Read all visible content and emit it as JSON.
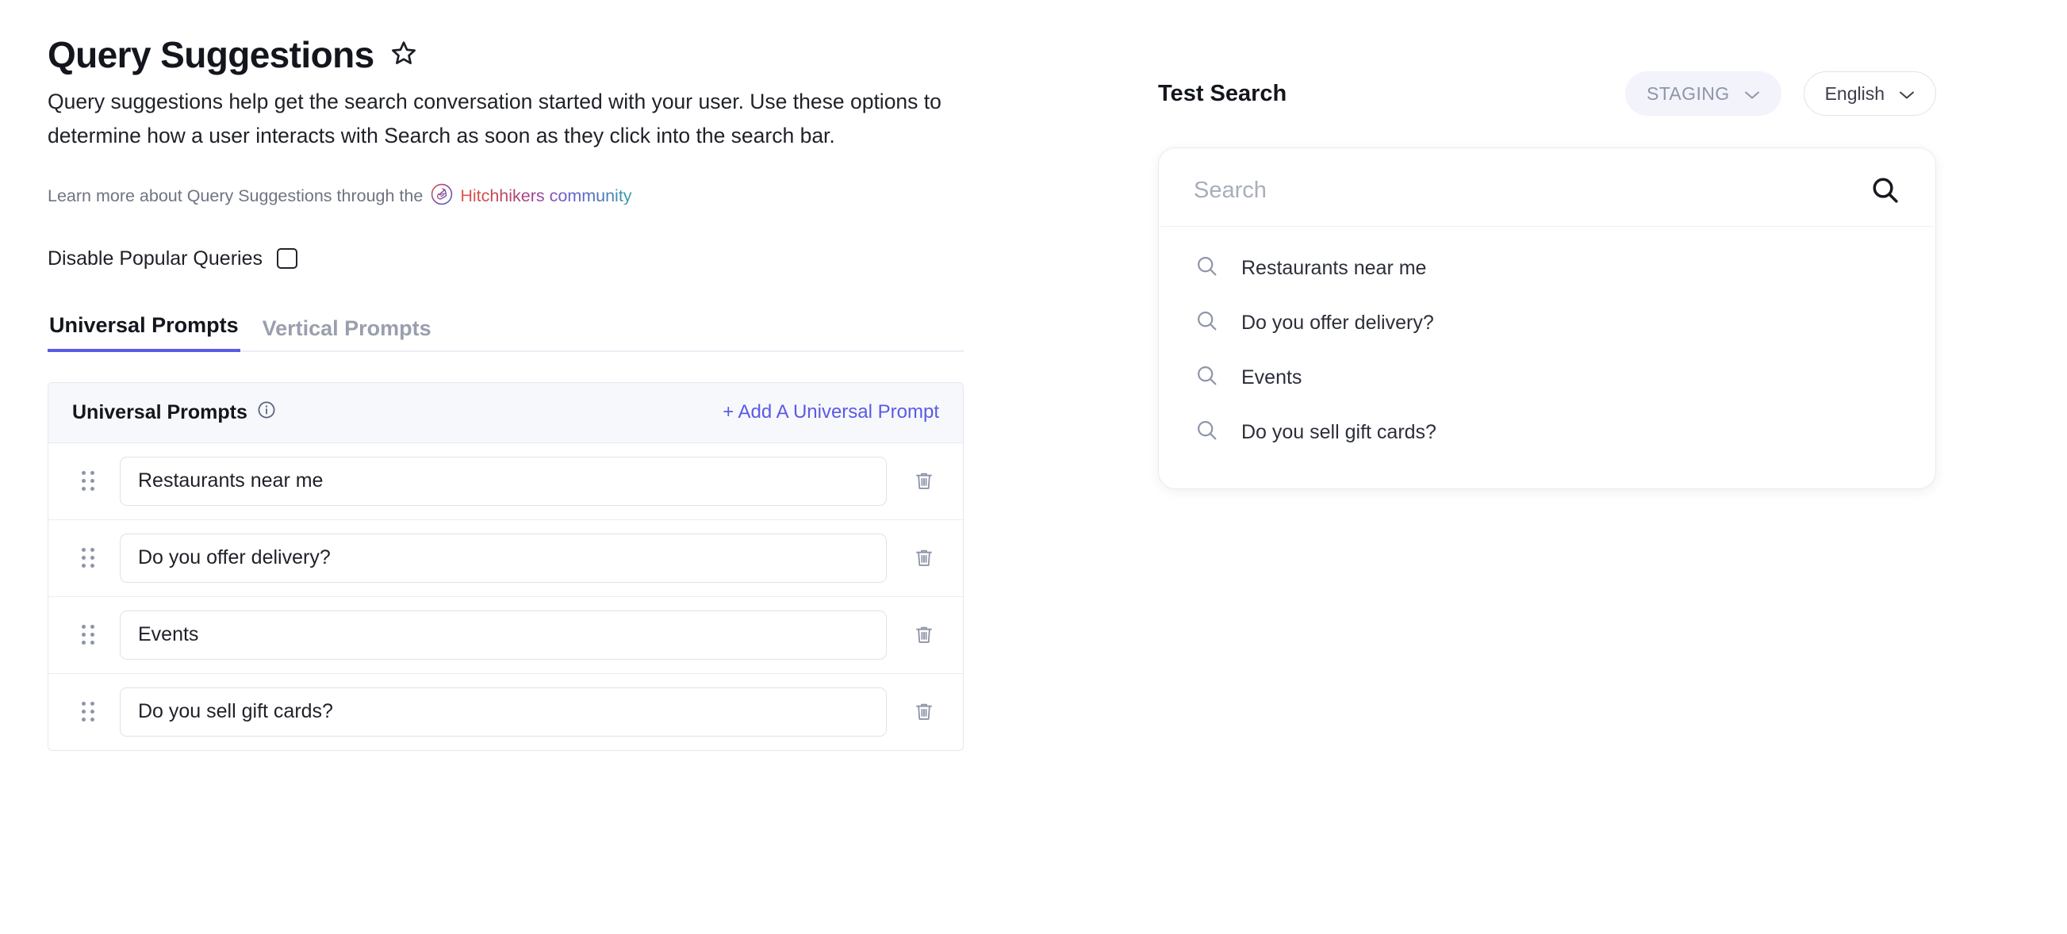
{
  "header": {
    "title": "Query Suggestions",
    "star_icon": "star-outline-icon",
    "description": "Query suggestions help get the search conversation started with your user. Use these options to determine how a user interacts with Search as soon as they click into the search bar.",
    "learn_more_prefix": "Learn more about Query Suggestions through the",
    "learn_more_link": "Hitchhikers community",
    "hitchhikers_badge_icon": "hitchhikers-hand-icon"
  },
  "disable_popular": {
    "label": "Disable Popular Queries",
    "checked": false
  },
  "tabs": [
    {
      "label": "Universal Prompts",
      "active": true
    },
    {
      "label": "Vertical Prompts",
      "active": false
    }
  ],
  "prompts_card": {
    "heading": "Universal Prompts",
    "info_icon": "info-circle-icon",
    "add_label": "+ Add A Universal Prompt",
    "rows": [
      {
        "value": "Restaurants near me",
        "drag_icon": "drag-handle-icon",
        "delete_icon": "trash-icon"
      },
      {
        "value": "Do you offer delivery?",
        "drag_icon": "drag-handle-icon",
        "delete_icon": "trash-icon"
      },
      {
        "value": "Events",
        "drag_icon": "drag-handle-icon",
        "delete_icon": "trash-icon"
      },
      {
        "value": "Do you sell gift cards?",
        "drag_icon": "drag-handle-icon",
        "delete_icon": "trash-icon"
      }
    ]
  },
  "test_search": {
    "title": "Test Search",
    "environment": "STAGING",
    "language": "English",
    "chevron_icon": "chevron-down-icon",
    "search_placeholder": "Search",
    "search_value": "",
    "search_icon": "search-icon",
    "suggestions": [
      {
        "label": "Restaurants near me",
        "icon": "search-icon"
      },
      {
        "label": "Do you offer delivery?",
        "icon": "search-icon"
      },
      {
        "label": "Events",
        "icon": "search-icon"
      },
      {
        "label": "Do you sell gift cards?",
        "icon": "search-icon"
      }
    ]
  },
  "colors": {
    "accent": "#5a5ae6",
    "card_header_bg": "#f7f8fc",
    "muted_text": "#6f7482",
    "trash": "#8e95a8"
  }
}
